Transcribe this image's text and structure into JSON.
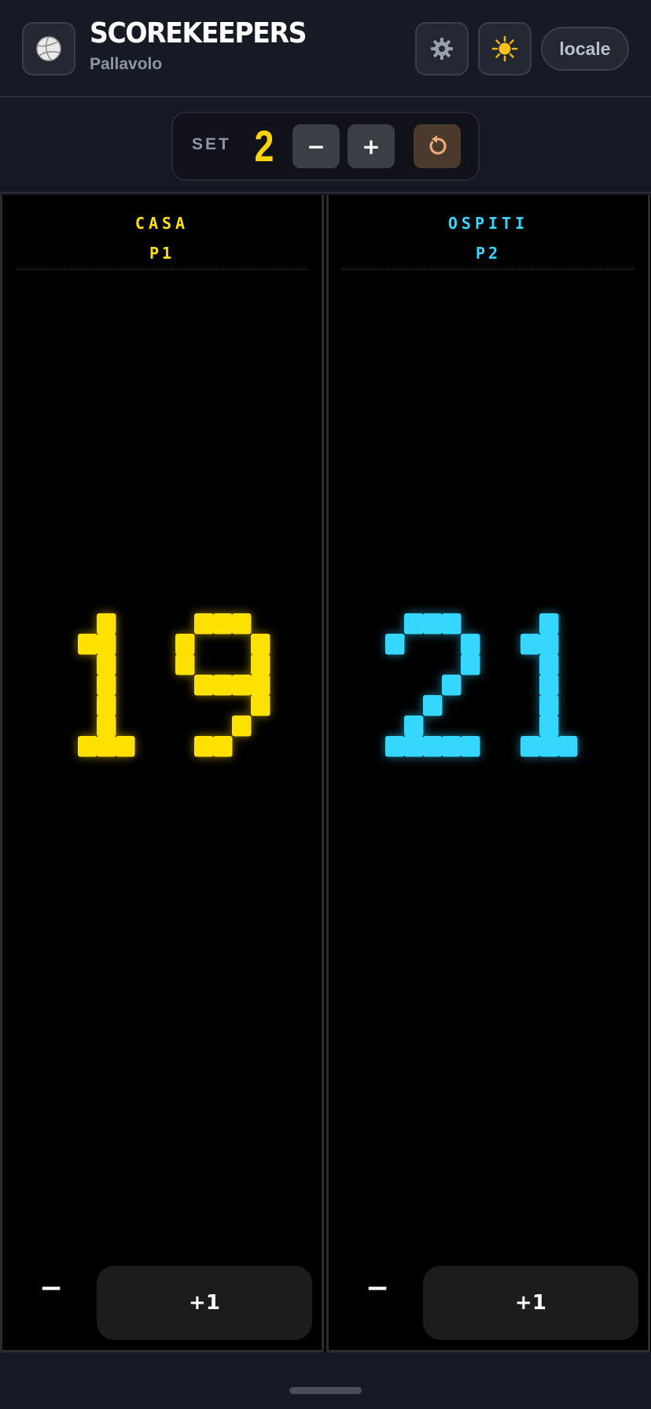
{
  "header": {
    "title": "SCOREKEEPERS",
    "subtitle": "Pallavolo",
    "logo_icon": "volleyball-icon",
    "settings_icon": "gear-icon",
    "theme_icon": "sun-icon",
    "locale_label": "locale"
  },
  "set_control": {
    "label": "SET",
    "value": "2",
    "decrement_label": "−",
    "increment_label": "+",
    "reset_icon": "reset-icon"
  },
  "teams": [
    {
      "name": "CASA",
      "player": "P1",
      "score": "19",
      "color": "#ffe100",
      "minus_label": "−",
      "plus_label": "+1"
    },
    {
      "name": "OSPITI",
      "player": "P2",
      "score": "21",
      "color": "#35d7ff",
      "minus_label": "−",
      "plus_label": "+1"
    }
  ],
  "colors": {
    "accent_yellow": "#ffd400",
    "accent_cyan": "#35d7ff",
    "reset_orange": "#f0a878"
  }
}
